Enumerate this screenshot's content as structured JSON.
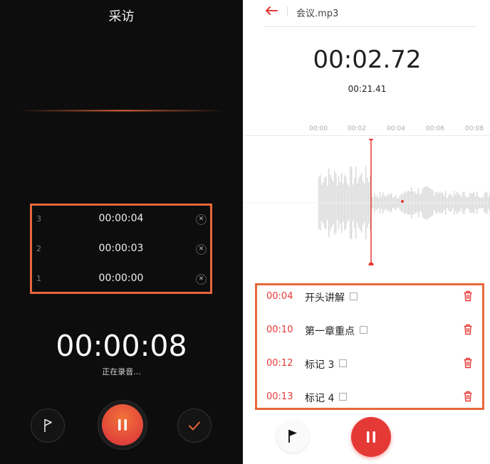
{
  "left": {
    "title": "采访",
    "markers": [
      {
        "index": "3",
        "time": "00:00:04"
      },
      {
        "index": "2",
        "time": "00:00:03"
      },
      {
        "index": "1",
        "time": "00:00:00"
      }
    ],
    "recording_time": "00:00:08",
    "status": "正在录音..."
  },
  "right": {
    "file_name": "会议.mp3",
    "playback_time": "00:02.72",
    "total_time": "00:21.41",
    "ruler_ticks": [
      "00:00",
      "00:02",
      "00:04",
      "00:06",
      "00:08"
    ],
    "marks": [
      {
        "time": "00:04",
        "label": "开头讲解"
      },
      {
        "time": "00:10",
        "label": "第一章重点"
      },
      {
        "time": "00:12",
        "label": "标记 3"
      },
      {
        "time": "00:13",
        "label": "标记 4"
      }
    ]
  },
  "colors": {
    "accent": "#e53935",
    "highlight_border": "#e8683a",
    "dark_bg": "#0d0d0d"
  },
  "icons": {
    "back": "arrow-left-icon",
    "flag": "flag-icon",
    "pause": "pause-icon",
    "done": "check-icon",
    "delete": "trash-icon",
    "remove": "close-circle-icon",
    "edit": "edit-icon"
  }
}
